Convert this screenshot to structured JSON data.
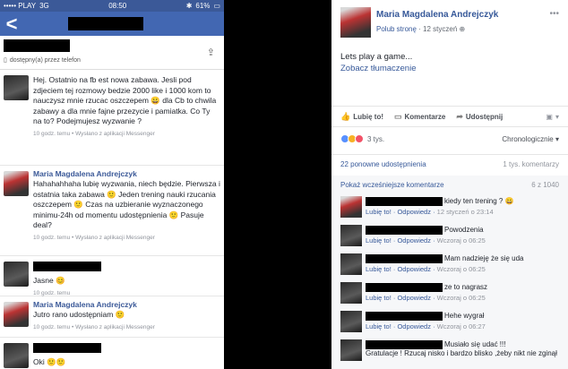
{
  "phone": {
    "status": {
      "carrier": "••••• PLAY",
      "network": "3G",
      "time": "08:50",
      "battery": "61%"
    },
    "nav_back": "<",
    "presence": "dostępny(a) przez telefon",
    "messages": [
      {
        "name": "",
        "text": "Hej. Ostatnio na fb est nowa zabawa. Jesli pod zdjeciem tej rozmowy bedzie 2000 like i 1000 kom to nauczysz mnie rzucac oszczepem 😀 dla Cb to chwila zabawy a dla mnie fajne przezycie i pamiatka. Co Ty na to? Podejmujesz wyzwanie ?",
        "meta": "10 godz. temu • Wysłano z aplikacji Messenger"
      },
      {
        "name": "Maria Magdalena Andrejczyk",
        "text": "Hahahahhaha lubię wyzwania, niech będzie. Pierwsza i ostatnia taka zabawa 🙂 Jeden trening nauki rzucania oszczepem 🙂 Czas na uzbieranie wyznaczonego minimu-24h od momentu udostępnienia 🙂 Pasuje deal?",
        "meta": "10 godz. temu • Wysłano z aplikacji Messenger"
      },
      {
        "name": "",
        "text": "Jasne 😊",
        "meta": "10 godz. temu"
      },
      {
        "name": "Maria Magdalena Andrejczyk",
        "text": "Jutro rano udostępniam 🙂",
        "meta": "10 godz. temu • Wysłano z aplikacji Messenger"
      },
      {
        "name": "",
        "text": "Oki 🙂🙂",
        "meta": ""
      }
    ]
  },
  "fb": {
    "page_name": "Maria Magdalena Andrejczyk",
    "like_page": "Polub stronę",
    "date": "12 styczeń",
    "post_text": "Lets play a game...",
    "translate": "Zobacz tłumaczenie",
    "actions": {
      "like": "Lubię to!",
      "comment": "Komentarze",
      "share": "Udostępnij"
    },
    "reactions_count": "3 tys.",
    "sort": "Chronologicznie",
    "shares": "22 ponowne udostępnienia",
    "comments_count": "1 tys. komentarzy",
    "prev": "Pokaż wcześniejsze komentarze",
    "prev_count": "6 z 1040",
    "comments": [
      {
        "text": "kiedy ten trening ? 😀",
        "time": "12 styczeń o 23:14"
      },
      {
        "text": "Powodzenia",
        "time": "Wczoraj o 06:25"
      },
      {
        "text": "Mam nadzieję że się uda",
        "time": "Wczoraj o 06:25"
      },
      {
        "text": "ze to nagrasz",
        "time": "Wczoraj o 06:25"
      },
      {
        "text": "Hehe wygrał",
        "time": "Wczoraj o 06:27"
      },
      {
        "text": "Musiało się udać !!!",
        "text2": "Gratulacje ! Rzucaj nisko i bardzo blisko ,żeby nikt nie zginął"
      }
    ],
    "comment_like": "Lubię to!",
    "comment_reply": "Odpowiedz"
  }
}
